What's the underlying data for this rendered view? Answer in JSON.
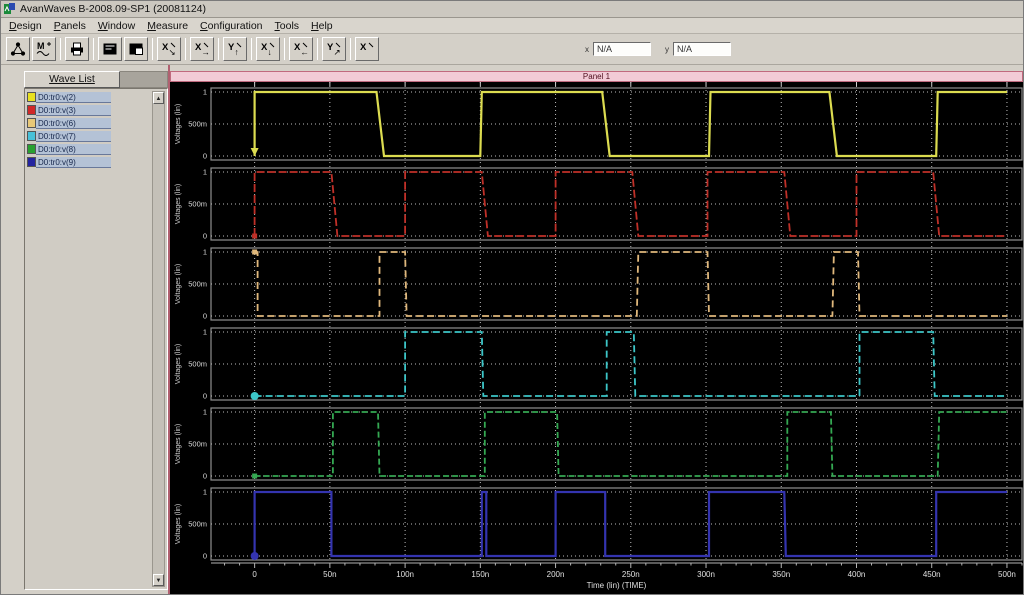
{
  "window": {
    "title": "AvanWaves B-2008.09-SP1 (20081124)"
  },
  "menu": {
    "items": [
      "Design",
      "Panels",
      "Window",
      "Measure",
      "Configuration",
      "Tools",
      "Help"
    ]
  },
  "toolbar": {
    "buttons": [
      {
        "name": "design-browser-button",
        "glyph": "hierarchy"
      },
      {
        "name": "measure-button",
        "glyph": "measure-wave"
      },
      {
        "name": "print-button",
        "glyph": "printer"
      },
      {
        "name": "panel-view-button",
        "glyph": "panel-dark"
      },
      {
        "name": "panel-overlay-button",
        "glyph": "panel-copy"
      },
      {
        "name": "zoom-x-out-button",
        "glyph": "probe",
        "letter": "X",
        "arrow": "↘"
      },
      {
        "name": "pan-right-button",
        "glyph": "probe",
        "letter": "X",
        "arrow": "→"
      },
      {
        "name": "zoom-y-up-button",
        "glyph": "probe",
        "letter": "Y",
        "arrow": "↑"
      },
      {
        "name": "zoom-x-down-button",
        "glyph": "probe",
        "letter": "X",
        "arrow": "↓"
      },
      {
        "name": "pan-left-button",
        "glyph": "probe",
        "letter": "X",
        "arrow": "←"
      },
      {
        "name": "zoom-y-diag-button",
        "glyph": "probe",
        "letter": "Y",
        "arrow": "↗"
      },
      {
        "name": "unzoom-button",
        "glyph": "probe",
        "letter": "X",
        "arrow": ""
      }
    ],
    "separators_after": [
      1,
      2,
      4,
      5,
      6,
      7,
      8,
      9,
      10
    ],
    "coord_fields": [
      {
        "label": "x",
        "value": "N/A"
      },
      {
        "label": "y",
        "value": "N/A"
      }
    ]
  },
  "sidebar": {
    "tab_label": "Wave List",
    "waves": [
      {
        "label": "D0:tr0:v(2)",
        "color": "#e8e020"
      },
      {
        "label": "D0:tr0:v(3)",
        "color": "#d02828"
      },
      {
        "label": "D0:tr0:v(6)",
        "color": "#e8c878"
      },
      {
        "label": "D0:tr0:v(7)",
        "color": "#48c0d8"
      },
      {
        "label": "D0:tr0:v(8)",
        "color": "#28a030"
      },
      {
        "label": "D0:tr0:v(9)",
        "color": "#2424a0"
      }
    ]
  },
  "panel": {
    "title": "Panel 1"
  },
  "chart_data": {
    "type": "line",
    "title": "Panel 1",
    "x_axis": {
      "label": "Time (lin) (TIME)",
      "unit": "ns",
      "range": [
        -29,
        510
      ],
      "tick_values": [
        0,
        50,
        100,
        150,
        200,
        250,
        300,
        350,
        400,
        450,
        500
      ],
      "tick_labels": [
        "0",
        "50n",
        "100n",
        "150n",
        "200n",
        "250n",
        "300n",
        "350n",
        "400n",
        "450n",
        "500n"
      ]
    },
    "y_axis": {
      "label": "Voltages (lin)",
      "range": [
        0,
        1
      ],
      "tick_values": [
        1,
        0.5,
        0
      ],
      "tick_labels": [
        "1",
        "500m",
        "0"
      ]
    },
    "grid": {
      "color": "#bdbdbd",
      "style": "dotted"
    },
    "signals": [
      {
        "name": "v(2)",
        "color": "#dcdc50",
        "dash": "",
        "width": 2.2,
        "marker": {
          "shape": "arrow-down",
          "at": [
            0,
            0
          ]
        },
        "points": [
          [
            0,
            0
          ],
          [
            0,
            1
          ],
          [
            81,
            1
          ],
          [
            86,
            0
          ],
          [
            150,
            0
          ],
          [
            151,
            1
          ],
          [
            231,
            1
          ],
          [
            236,
            0
          ],
          [
            302,
            0
          ],
          [
            303,
            1
          ],
          [
            382,
            1
          ],
          [
            387,
            0
          ],
          [
            453,
            0
          ],
          [
            454,
            1
          ],
          [
            500,
            1
          ]
        ]
      },
      {
        "name": "v(3)",
        "color": "#c03028",
        "dash": "8,3",
        "width": 1.8,
        "marker": {
          "shape": "square",
          "at": [
            0,
            0
          ]
        },
        "points": [
          [
            0,
            0
          ],
          [
            0,
            1
          ],
          [
            51,
            1
          ],
          [
            55,
            0
          ],
          [
            100,
            0
          ],
          [
            100,
            1
          ],
          [
            151,
            1
          ],
          [
            155,
            0
          ],
          [
            200,
            0
          ],
          [
            200,
            1
          ],
          [
            251,
            1
          ],
          [
            255,
            0
          ],
          [
            301,
            0
          ],
          [
            301,
            1
          ],
          [
            352,
            1
          ],
          [
            356,
            0
          ],
          [
            400,
            0
          ],
          [
            400,
            1
          ],
          [
            451,
            1
          ],
          [
            455,
            0
          ],
          [
            500,
            0
          ]
        ]
      },
      {
        "name": "v(6)",
        "color": "#e0b87c",
        "dash": "7,4",
        "width": 1.8,
        "marker": {
          "shape": "square",
          "at": [
            0,
            1
          ]
        },
        "points": [
          [
            0,
            1
          ],
          [
            2,
            1
          ],
          [
            2,
            0
          ],
          [
            83,
            0
          ],
          [
            83,
            1
          ],
          [
            100,
            1
          ],
          [
            101,
            0
          ],
          [
            254,
            0
          ],
          [
            255,
            1
          ],
          [
            301,
            1
          ],
          [
            302,
            0
          ],
          [
            384,
            0
          ],
          [
            385,
            1
          ],
          [
            401,
            1
          ],
          [
            402,
            0
          ],
          [
            500,
            0
          ]
        ]
      },
      {
        "name": "v(7)",
        "color": "#3cc6c8",
        "dash": "7,4",
        "width": 1.8,
        "marker": {
          "shape": "circle",
          "at": [
            0,
            0
          ]
        },
        "points": [
          [
            0,
            0
          ],
          [
            100,
            0
          ],
          [
            100,
            1
          ],
          [
            151,
            1
          ],
          [
            152,
            0
          ],
          [
            234,
            0
          ],
          [
            234,
            1
          ],
          [
            252,
            1
          ],
          [
            253,
            0
          ],
          [
            402,
            0
          ],
          [
            402,
            1
          ],
          [
            451,
            1
          ],
          [
            452,
            0
          ],
          [
            500,
            0
          ]
        ]
      },
      {
        "name": "v(8)",
        "color": "#34a852",
        "dash": "6,3",
        "width": 1.8,
        "marker": {
          "shape": "square",
          "at": [
            0,
            0
          ]
        },
        "points": [
          [
            0,
            0
          ],
          [
            52,
            0
          ],
          [
            52,
            1
          ],
          [
            82,
            1
          ],
          [
            83,
            0
          ],
          [
            153,
            0
          ],
          [
            153,
            1
          ],
          [
            201,
            1
          ],
          [
            202,
            0
          ],
          [
            354,
            0
          ],
          [
            354,
            1
          ],
          [
            383,
            1
          ],
          [
            384,
            0
          ],
          [
            454,
            0
          ],
          [
            455,
            1
          ],
          [
            500,
            1
          ]
        ]
      },
      {
        "name": "v(9)",
        "color": "#3434b0",
        "dash": "",
        "width": 2.2,
        "marker": {
          "shape": "circle",
          "at": [
            0,
            0
          ]
        },
        "points": [
          [
            0,
            0
          ],
          [
            0,
            1
          ],
          [
            51,
            1
          ],
          [
            51,
            0
          ],
          [
            151,
            0
          ],
          [
            151,
            1
          ],
          [
            154,
            1
          ],
          [
            154,
            0
          ],
          [
            200,
            0
          ],
          [
            200,
            1
          ],
          [
            233,
            1
          ],
          [
            233,
            0
          ],
          [
            302,
            0
          ],
          [
            302,
            1
          ],
          [
            352,
            1
          ],
          [
            353,
            0
          ],
          [
            453,
            0
          ],
          [
            453,
            1
          ],
          [
            500,
            1
          ]
        ]
      }
    ]
  }
}
